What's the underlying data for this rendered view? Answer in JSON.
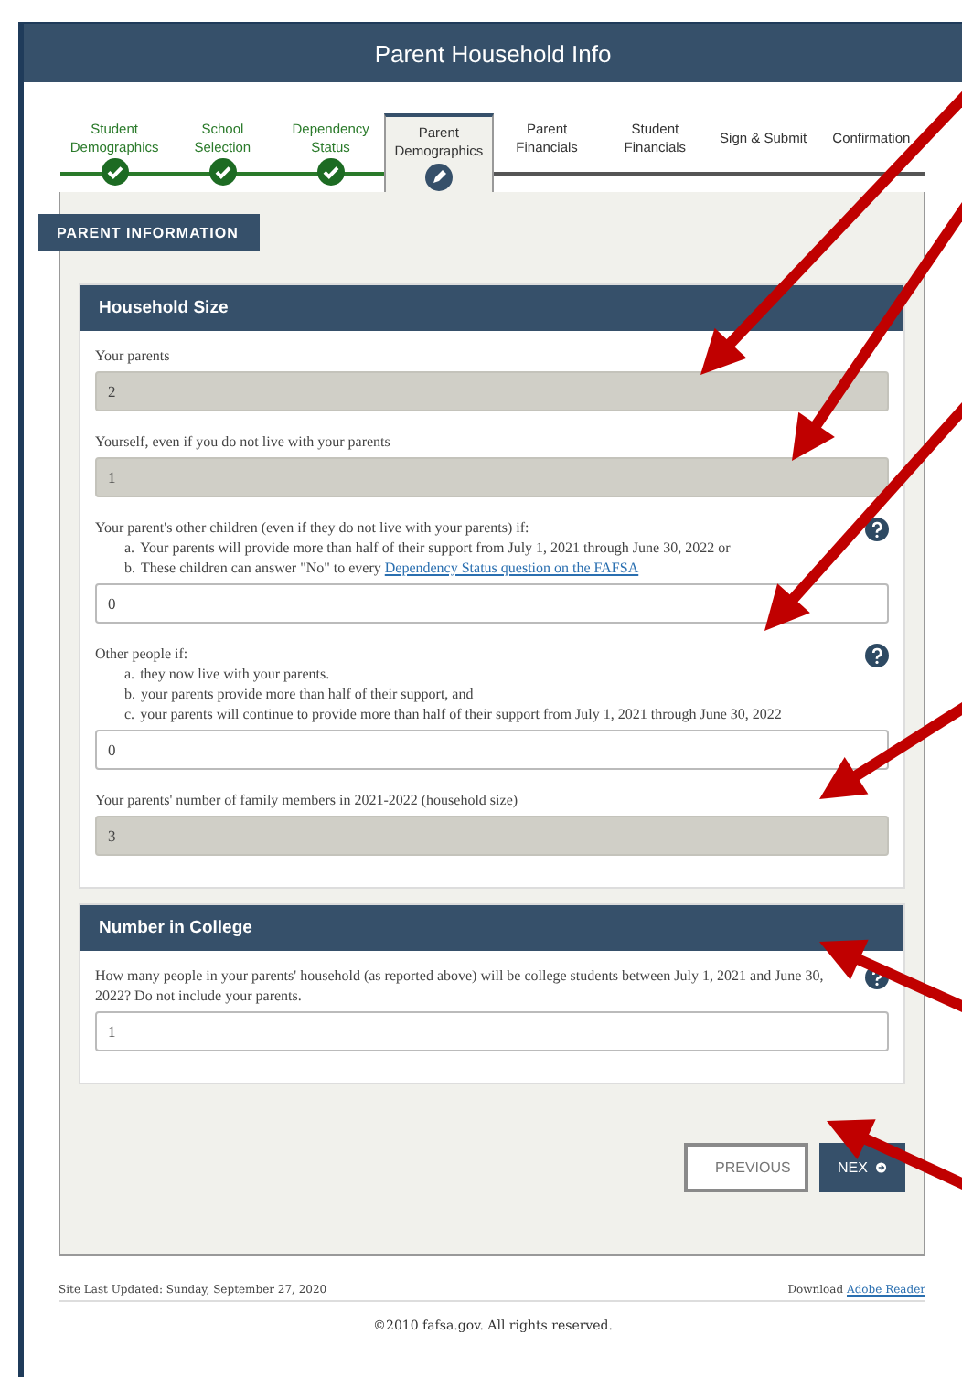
{
  "window": {
    "title": "Parent Household Info"
  },
  "steps": [
    {
      "label": "Student Demographics",
      "kind": "complete",
      "selected": false
    },
    {
      "label": "School Selection",
      "kind": "complete",
      "selected": false
    },
    {
      "label": "Dependency Status",
      "kind": "complete",
      "selected": false
    },
    {
      "label": "Parent Demographics",
      "kind": "current",
      "selected": true
    },
    {
      "label": "Parent Financials",
      "kind": "upcoming",
      "selected": false
    },
    {
      "label": "Student Financials",
      "kind": "upcoming",
      "selected": false
    },
    {
      "label": "Sign & Submit",
      "kind": "upcoming",
      "selected": false
    },
    {
      "label": "Confirmation",
      "kind": "upcoming",
      "selected": false
    }
  ],
  "section_tab": "PARENT INFORMATION",
  "cards": [
    {
      "title": "Household Size",
      "fields": [
        {
          "label": "Your parents",
          "value": "2",
          "disabled": true,
          "help": false
        },
        {
          "label": "Yourself, even if you do not live with your parents",
          "value": "1",
          "disabled": true,
          "help": false
        },
        {
          "label": "Your parent's other children (even if they do not live with your parents) if:",
          "items": [
            {
              "marker": "a.",
              "text": "Your parents will provide more than half of their support from July 1, 2021 through June 30, 2022 or"
            },
            {
              "marker": "b.",
              "text": "These children can answer \"No\" to every ",
              "link": "Dependency Status question on the FAFSA"
            }
          ],
          "value": "0",
          "disabled": false,
          "help": true
        },
        {
          "label": "Other people if:",
          "items": [
            {
              "marker": "a.",
              "text": "they now live with your parents."
            },
            {
              "marker": "b.",
              "text": "your parents provide more than half of their support, and"
            },
            {
              "marker": "c.",
              "text": "your parents will continue to provide more than half of their support from July 1, 2021 through June 30, 2022"
            }
          ],
          "value": "0",
          "disabled": false,
          "help": true
        },
        {
          "label": "Your parents' number of family members in 2021-2022 (household size)",
          "value": "3",
          "disabled": true,
          "help": false
        }
      ]
    },
    {
      "title": "Number in College",
      "fields": [
        {
          "label": "How many people in your parents' household (as reported above) will be college students between July 1, 2021 and June 30, 2022? Do not include your parents.",
          "value": "1",
          "disabled": false,
          "help": true
        }
      ]
    }
  ],
  "buttons": [
    {
      "kind": "previous",
      "label": "PREVIOUS"
    },
    {
      "kind": "next",
      "label": "NEX"
    }
  ],
  "footer": {
    "updated": "Site Last Updated: Sunday, September 27, 2020",
    "download": "Download",
    "download_link": "Adobe Reader",
    "copyright": "©2010 fafsa.gov. All rights reserved."
  }
}
